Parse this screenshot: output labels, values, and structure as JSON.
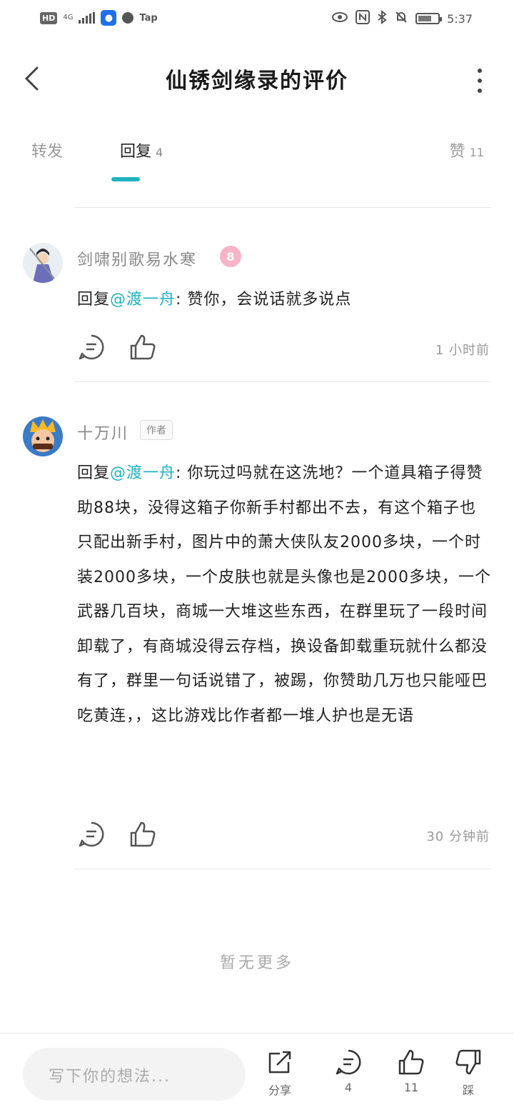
{
  "status_bar": {
    "hd": "HD",
    "network": "4G",
    "app": "Tap",
    "time": "5:37"
  },
  "header": {
    "title": "仙锈剑缘录的评价"
  },
  "tabs": {
    "forward": "转发",
    "reply": "回复",
    "reply_count": "4",
    "like": "赞",
    "like_count": "11"
  },
  "comments": [
    {
      "name": "剑啸别歌易水寒",
      "level": "8",
      "reply_prefix": "回复",
      "mention": "@渡一舟",
      "text": ": 赞你，会说话就多说点",
      "time": "1 小时前"
    },
    {
      "name": "十万川",
      "author_tag": "作者",
      "reply_prefix": "回复",
      "mention": "@渡一舟",
      "text": ": 你玩过吗就在这洗地？一个道具箱子得赞助88块，没得这箱子你新手村都出不去，有这个箱子也只配出新手村，图片中的萧大侠队友2000多块，一个时装2000多块，一个皮肤也就是头像也是2000多块，一个武器几百块，商城一大堆这些东西，在群里玩了一段时间卸载了，有商城没得云存档，换设备卸载重玩就什么都没有了，群里一句话说错了，被踢，你赞助几万也只能哑巴吃黄连，，这比游戏比作者都一堆人护也是无语",
      "time": "30 分钟前"
    }
  ],
  "footer_text": "暂无更多",
  "bottom_bar": {
    "input_placeholder": "写下你的想法...",
    "share_label": "分享",
    "comment_count": "4",
    "like_count": "11",
    "dislike_label": "踩"
  },
  "colors": {
    "accent": "#1fb3c0",
    "text": "#222222",
    "muted": "#999999"
  }
}
